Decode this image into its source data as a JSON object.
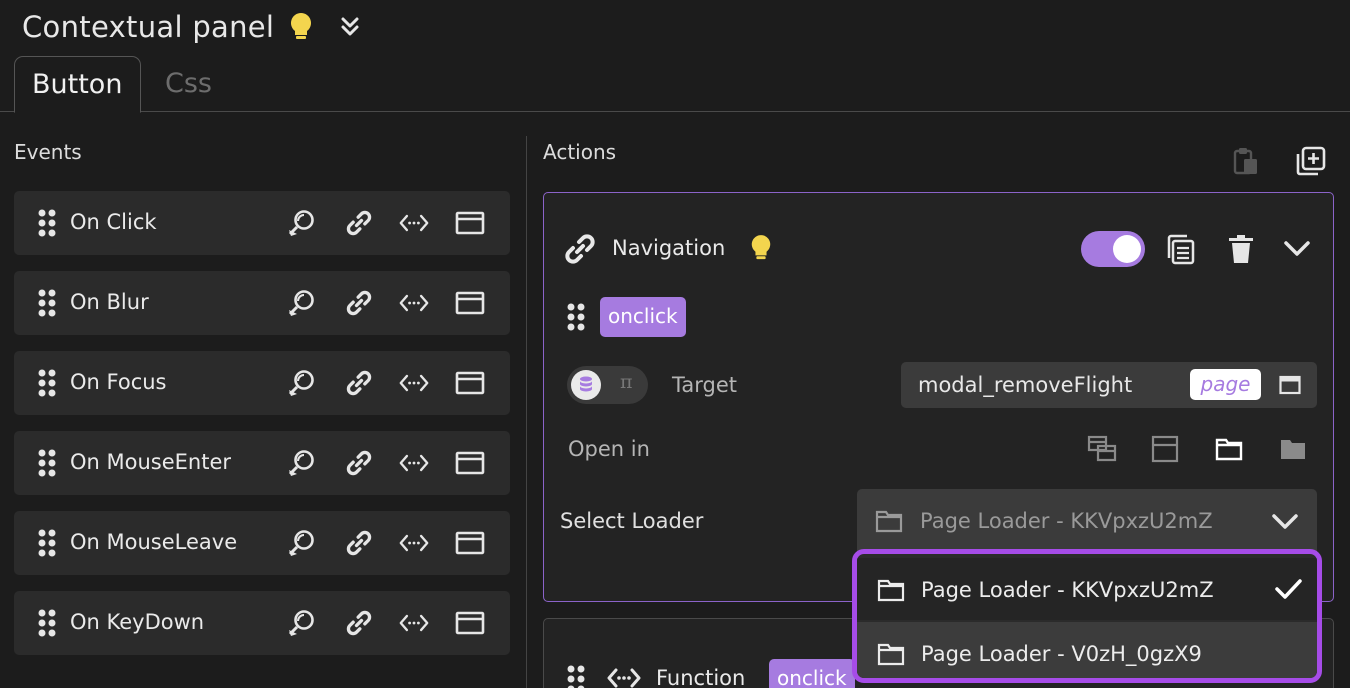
{
  "header": {
    "title": "Contextual panel"
  },
  "tabs": [
    {
      "label": "Button"
    },
    {
      "label": "Css"
    }
  ],
  "events": {
    "label": "Events",
    "items": [
      {
        "label": "On Click"
      },
      {
        "label": "On Blur"
      },
      {
        "label": "On Focus"
      },
      {
        "label": "On MouseEnter"
      },
      {
        "label": "On MouseLeave"
      },
      {
        "label": "On KeyDown"
      }
    ]
  },
  "actions": {
    "label": "Actions",
    "navigation": {
      "title": "Navigation",
      "event_tag": "onclick",
      "enabled": true,
      "target": {
        "label": "Target",
        "value": "modal_removeFlight",
        "badge": "page"
      },
      "open_in": {
        "label": "Open in"
      },
      "loader": {
        "label": "Select Loader",
        "selected": "Page Loader - KKVpxzU2mZ",
        "options": [
          {
            "label": "Page Loader - KKVpxzU2mZ",
            "checked": true
          },
          {
            "label": "Page Loader - V0zH_0gzX9",
            "checked": false
          }
        ]
      }
    },
    "function": {
      "title": "Function",
      "event_tag": "onclick"
    }
  },
  "source_toggle": {
    "alt_symbol": "π"
  },
  "colors": {
    "accent": "#a67be0",
    "highlight": "#a64ce8",
    "bulb": "#f3d54e",
    "background": "#1c1c1c"
  }
}
